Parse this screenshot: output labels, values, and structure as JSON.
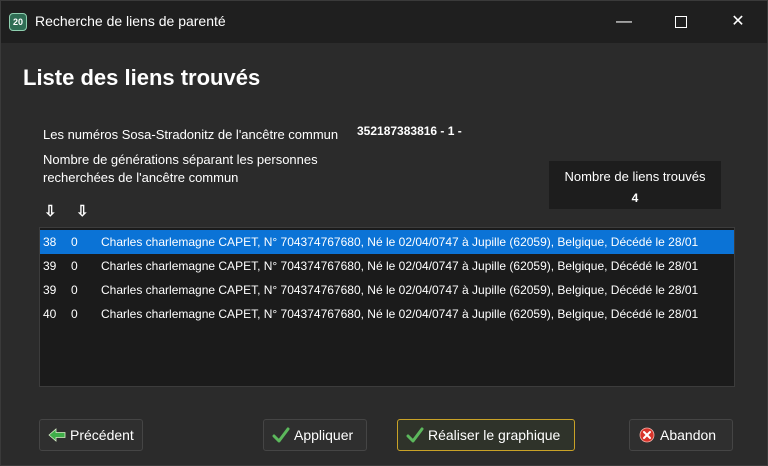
{
  "window": {
    "app_icon_text": "20",
    "title": "Recherche de liens de parenté",
    "minimize_glyph": "—",
    "close_glyph": "✕"
  },
  "main": {
    "heading": "Liste des liens trouvés",
    "sosa_label": "Les numéros Sosa-Stradonitz de l'ancêtre commun",
    "sosa_value": "352187383816 - 1 -",
    "generations_label": "Nombre de générations séparant les personnes recherchées de l'ancêtre commun",
    "links_count_label": "Nombre de liens trouvés",
    "links_count_value": "4",
    "sort_arrow_glyph": "⇩"
  },
  "list": {
    "rows": [
      {
        "gen1": "38",
        "gen2": "0",
        "text": "Charles charlemagne CAPET, N° 704374767680, Né le 02/04/0747 à Jupille (62059), Belgique, Décédé le 28/01",
        "selected": true
      },
      {
        "gen1": "39",
        "gen2": "0",
        "text": "Charles charlemagne CAPET, N° 704374767680, Né le 02/04/0747 à Jupille (62059), Belgique, Décédé le 28/01",
        "selected": false
      },
      {
        "gen1": "39",
        "gen2": "0",
        "text": "Charles charlemagne CAPET, N° 704374767680, Né le 02/04/0747 à Jupille (62059), Belgique, Décédé le 28/01",
        "selected": false
      },
      {
        "gen1": "40",
        "gen2": "0",
        "text": "Charles charlemagne CAPET, N° 704374767680, Né le 02/04/0747 à Jupille (62059), Belgique, Décédé le 28/01",
        "selected": false
      }
    ]
  },
  "buttons": {
    "previous": "Précédent",
    "apply": "Appliquer",
    "make_graph": "Réaliser le graphique",
    "abort": "Abandon"
  },
  "colors": {
    "selection": "#0b73d6",
    "accent_border": "#c9a227",
    "check_green": "#5cb85c",
    "arrow_green": "#3fae49",
    "abort_red": "#d9342b"
  },
  "icons": {
    "previous": "arrow-left-icon",
    "apply": "checkmark-icon",
    "make_graph": "checkmark-icon",
    "abort": "cancel-icon"
  }
}
